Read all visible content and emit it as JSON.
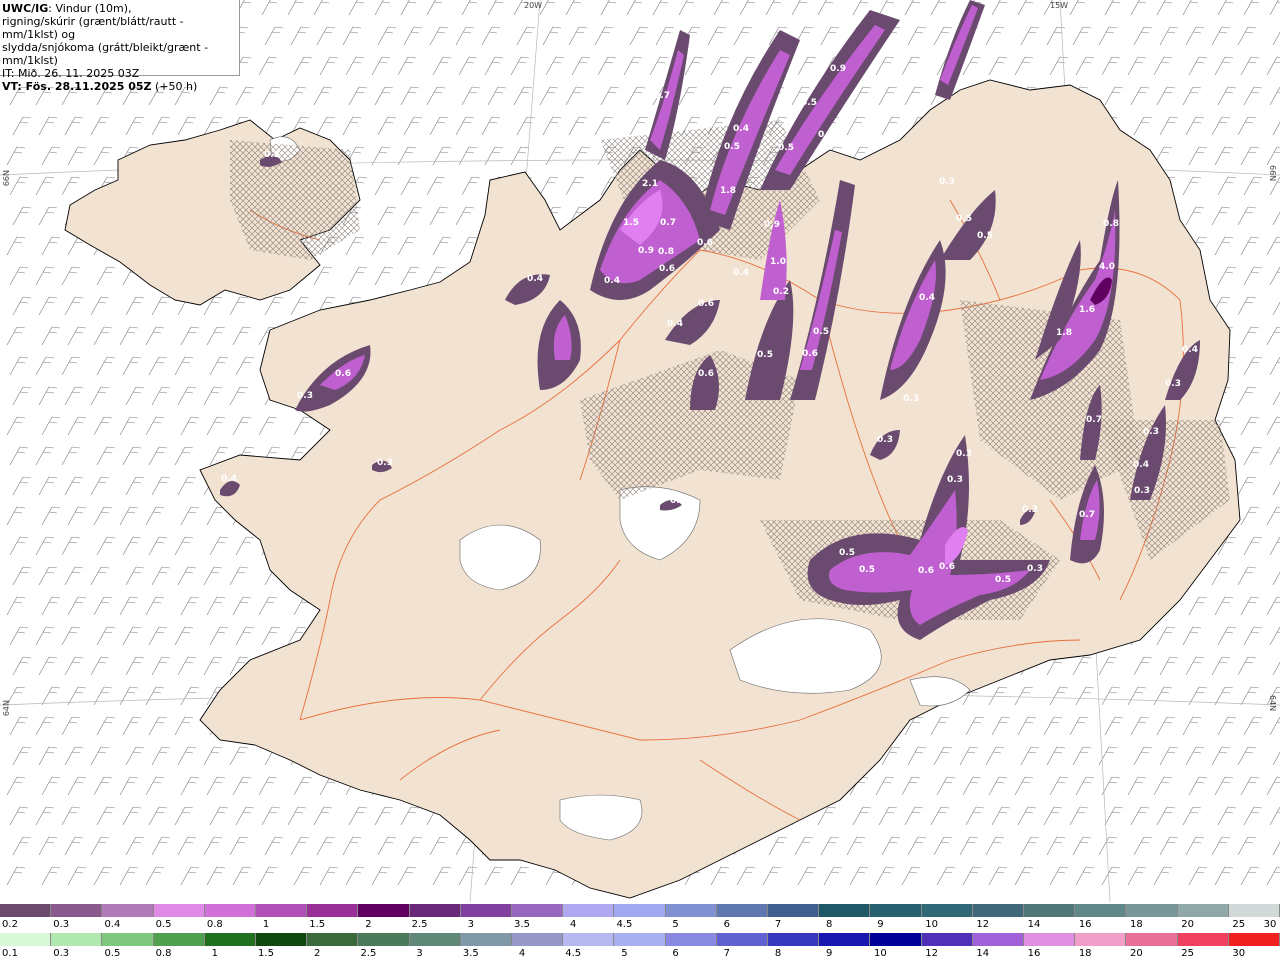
{
  "title_block": {
    "line1_bold": "UWC/IG",
    "line1_rest": ": Vindur (10m),",
    "line2": "rigning/skúrir (grænt/blátt/rautt - mm/1klst) og",
    "line3": "slydda/snjókoma (grátt/bleikt/grænt - mm/1klst)",
    "line4": "IT: Mið. 26. 11. 2025 03Z",
    "line5_bold": "VT: Fös. 28.11.2025 05Z",
    "line5_rest": " (+50 h)"
  },
  "axis_labels": {
    "top_20w": "20W",
    "top_15w": "15W",
    "left_66n": "66N",
    "left_64n": "64N",
    "right_66n": "66N",
    "right_64n": "64N"
  },
  "precip_labels": [
    "0.2",
    "0.4",
    "0.3",
    "0.6",
    "0.3",
    "0.4",
    "2.1",
    "1.5",
    "0.9",
    "0.8",
    "0.4",
    "0.6",
    "0.4",
    "0.6",
    "0.4",
    "0.6",
    "0.6",
    "0.7",
    "1.0",
    "0.9",
    "1.8",
    "0.5",
    "0.4",
    "0.5",
    "0.5",
    "0.2",
    "0.5",
    "0.5",
    "0.6",
    "0.9",
    "0.3",
    "0.5",
    "0.4",
    "0.5",
    "0.3",
    "0.2",
    "0.3",
    "0.3",
    "0.5",
    "0.5",
    "0.6",
    "0.6",
    "0.5",
    "0.3",
    "4.0",
    "1.6",
    "1.8",
    "0.8",
    "0.4",
    "0.3",
    "0.7",
    "0.3",
    "0.4",
    "0.3",
    "0.7",
    "0.3",
    "0.2",
    "0.3",
    "0.7"
  ],
  "scale_snow": {
    "labels": [
      "0.2",
      "0.3",
      "0.4",
      "0.5",
      "0.8",
      "1",
      "1.5",
      "2",
      "2.5",
      "3",
      "3.5",
      "4",
      "4.5",
      "5",
      "6",
      "7",
      "8",
      "9",
      "10",
      "12",
      "14",
      "16",
      "18",
      "20",
      "25",
      "30"
    ],
    "colors": [
      "#6b4a6e",
      "#8a5a8e",
      "#b07ab8",
      "#e08ae8",
      "#d070d8",
      "#b050b8",
      "#983098",
      "#600060",
      "#6a2878",
      "#8040a0",
      "#9868c0",
      "#b0a8f0",
      "#a0a8f0",
      "#8090d0",
      "#6078b0",
      "#406090",
      "#205868",
      "#286070",
      "#306878",
      "#406878",
      "#507878",
      "#608888",
      "#789898",
      "#90a8a8",
      "#d0d8d8"
    ]
  },
  "scale_rain": {
    "labels": [
      "0.1",
      "0.3",
      "0.5",
      "0.8",
      "1",
      "1.5",
      "2",
      "2.5",
      "3",
      "3.5",
      "4",
      "4.5",
      "5",
      "6",
      "7",
      "8",
      "9",
      "10",
      "12",
      "14",
      "16",
      "18",
      "20",
      "25",
      "30"
    ],
    "colors": [
      "#d8f8d8",
      "#b0e8b0",
      "#80c880",
      "#50a050",
      "#207020",
      "#104810",
      "#3a6a3a",
      "#4a7a5a",
      "#608878",
      "#8098a8",
      "#9898c8",
      "#b8b8f0",
      "#a8b0f0",
      "#8888e0",
      "#6060d0",
      "#3838c0",
      "#1818b0",
      "#000098",
      "#5030b8",
      "#a060d8",
      "#e090e0",
      "#f0a0c8",
      "#e87098",
      "#f04060",
      "#f02020"
    ]
  },
  "colors": {
    "land": "#f2e2d2",
    "coast": "#000000",
    "roads": "#e8703a",
    "glacier": "#ffffff",
    "precip_light": "#6a4a6e",
    "precip_mid": "#c060d0",
    "precip_high": "#e080f0",
    "wind_barb": "#7a7a7a"
  }
}
